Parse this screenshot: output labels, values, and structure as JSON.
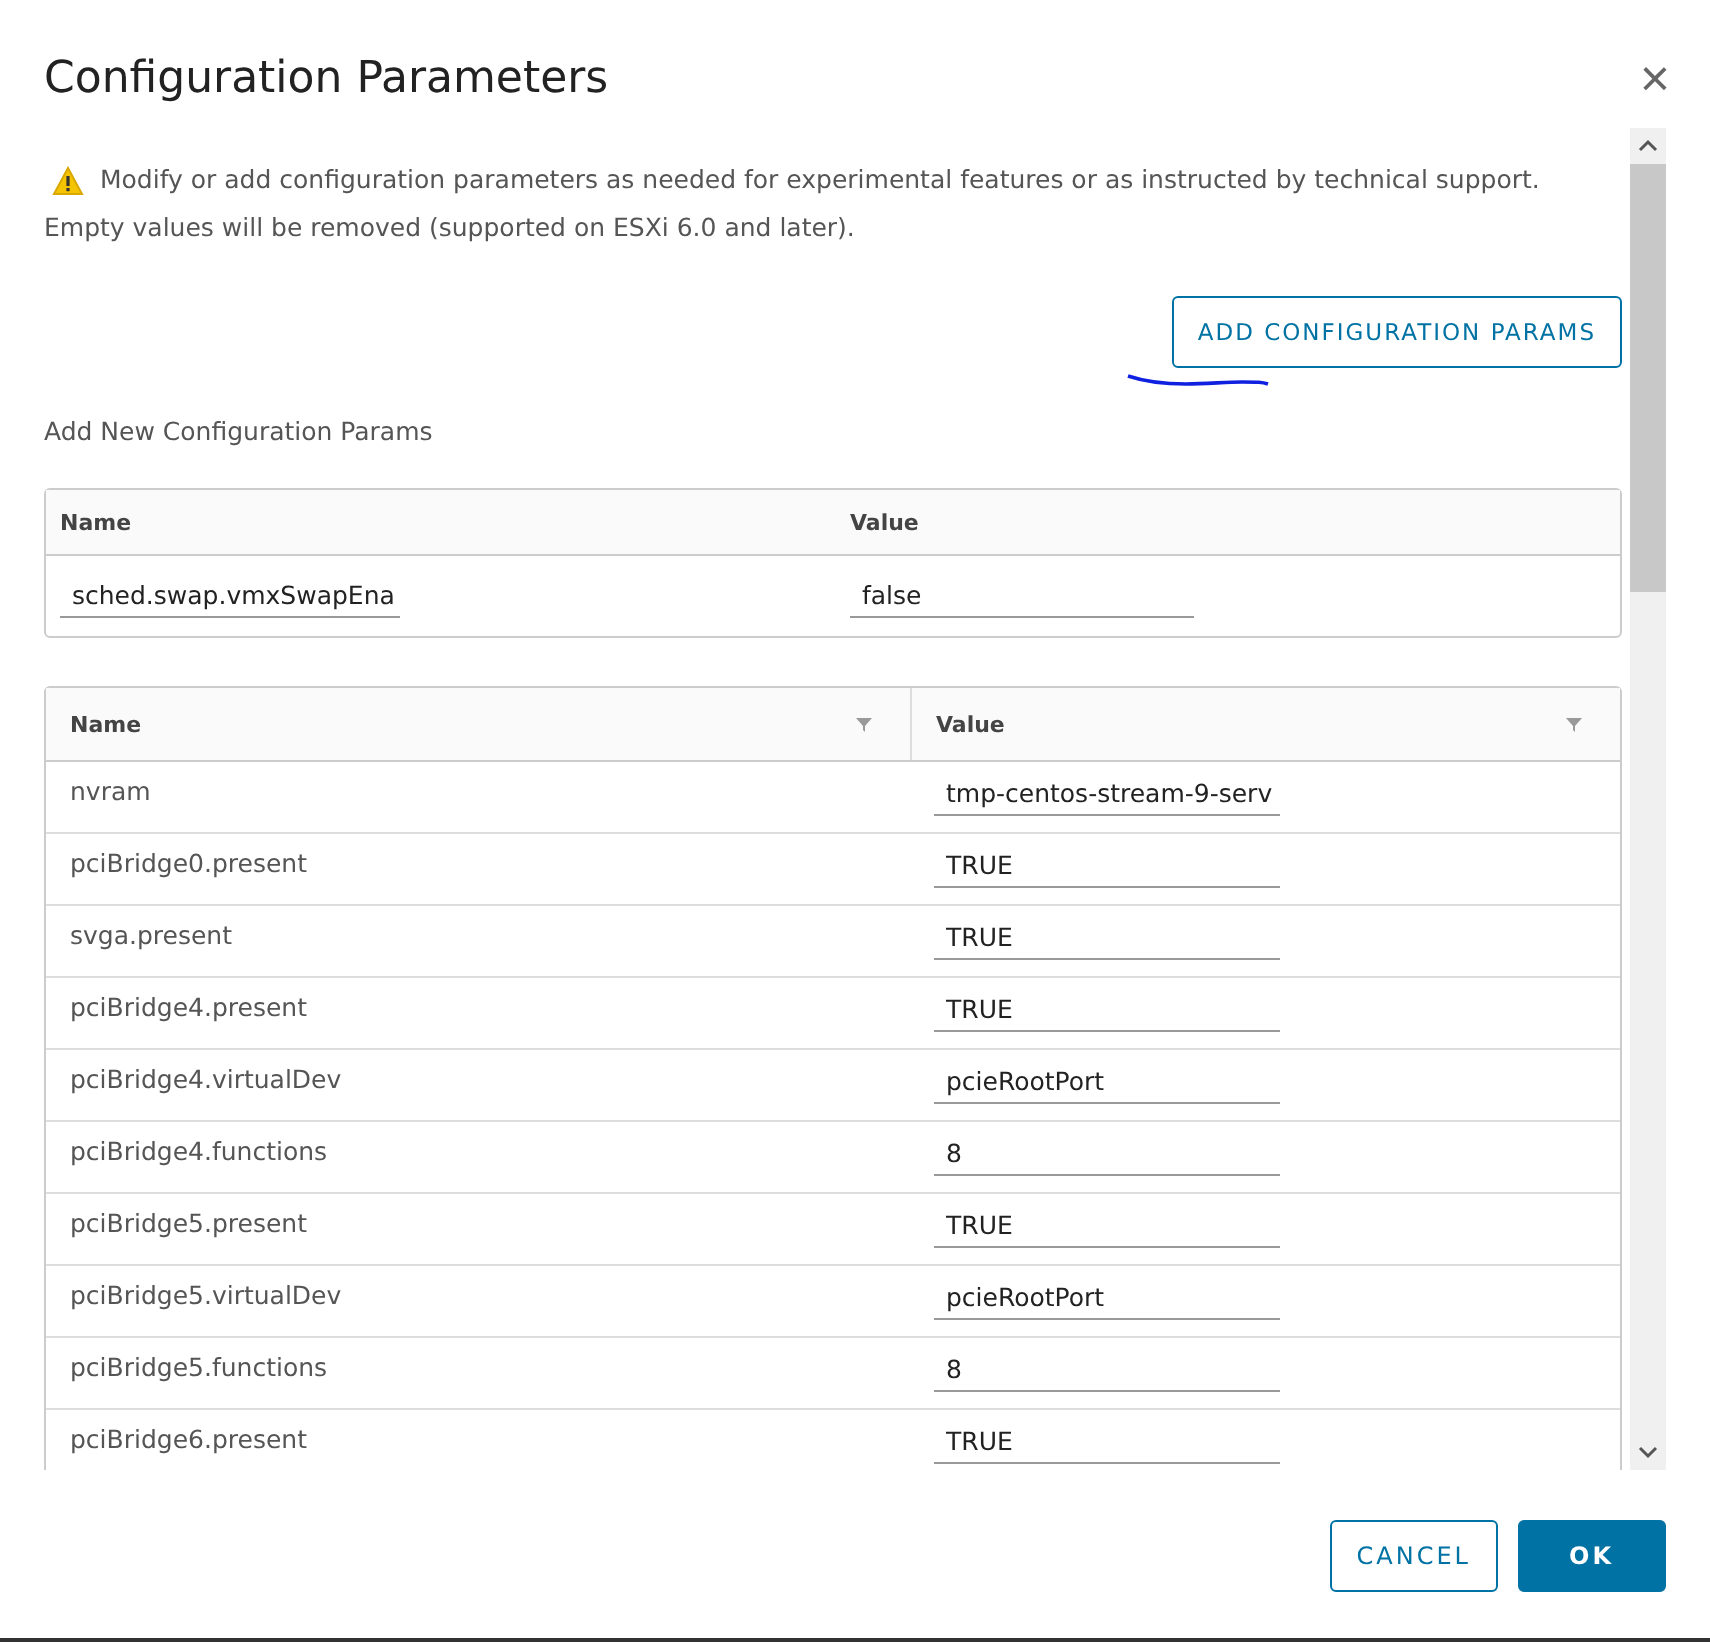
{
  "dialog": {
    "title": "Configuration Parameters",
    "close_label": "×"
  },
  "notice": {
    "text": "Modify or add configuration parameters as needed for experimental features or as instructed by technical support. Empty values will be removed (supported on ESXi 6.0 and later)."
  },
  "add_button": {
    "label": "ADD CONFIGURATION PARAMS"
  },
  "new_params": {
    "heading": "Add New Configuration Params",
    "columns": [
      "Name",
      "Value"
    ],
    "rows": [
      {
        "name": "sched.swap.vmxSwapEna",
        "value": "false"
      }
    ]
  },
  "params": {
    "columns": [
      "Name",
      "Value"
    ],
    "rows": [
      {
        "name": "nvram",
        "value": "tmp-centos-stream-9-serv"
      },
      {
        "name": "pciBridge0.present",
        "value": "TRUE"
      },
      {
        "name": "svga.present",
        "value": "TRUE"
      },
      {
        "name": "pciBridge4.present",
        "value": "TRUE"
      },
      {
        "name": "pciBridge4.virtualDev",
        "value": "pcieRootPort"
      },
      {
        "name": "pciBridge4.functions",
        "value": "8"
      },
      {
        "name": "pciBridge5.present",
        "value": "TRUE"
      },
      {
        "name": "pciBridge5.virtualDev",
        "value": "pcieRootPort"
      },
      {
        "name": "pciBridge5.functions",
        "value": "8"
      },
      {
        "name": "pciBridge6.present",
        "value": "TRUE"
      }
    ]
  },
  "footer": {
    "buttons": [
      {
        "label": "CANCEL",
        "kind": "secondary"
      },
      {
        "label": "OK",
        "kind": "primary"
      }
    ]
  }
}
